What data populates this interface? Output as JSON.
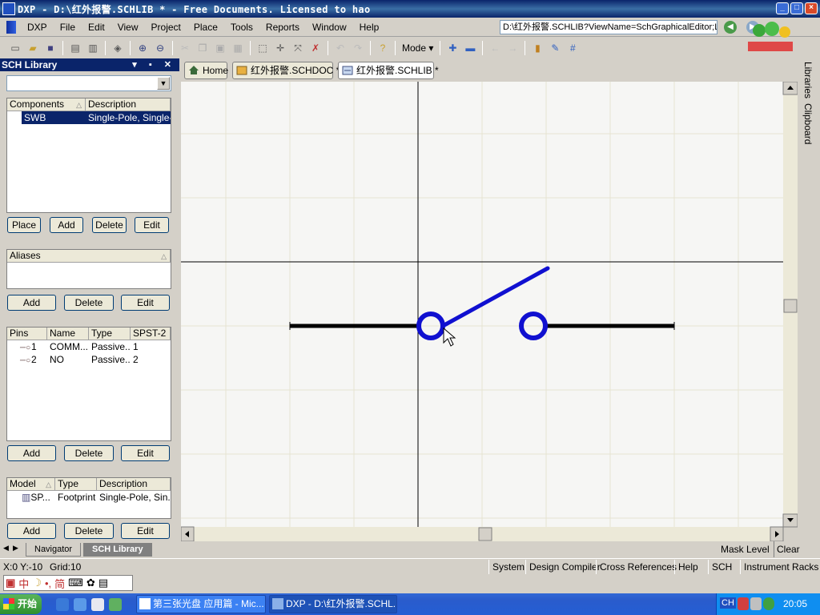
{
  "window": {
    "title": "DXP - D:\\红外报警.SCHLIB * - Free Documents. Licensed to hao",
    "buttons": [
      "minimize",
      "maximize",
      "close"
    ]
  },
  "menu": {
    "logo": "DXP",
    "items": [
      "File",
      "Edit",
      "View",
      "Project",
      "Place",
      "Tools",
      "Reports",
      "Window",
      "Help"
    ],
    "path": "D:\\红外报警.SCHLIB?ViewName=SchGraphicalEditor;L"
  },
  "toolbar": {
    "mode_label": "Mode"
  },
  "panel": {
    "title": "SCH Library",
    "components": {
      "headers": [
        "Components",
        "Description"
      ],
      "rows": [
        {
          "name": "SWB",
          "description": "Single-Pole, Single-..."
        }
      ],
      "buttons": [
        "Place",
        "Add",
        "Delete",
        "Edit"
      ]
    },
    "aliases": {
      "header": "Aliases",
      "buttons": [
        "Add",
        "Delete",
        "Edit"
      ]
    },
    "pins": {
      "headers": [
        "Pins",
        "Name",
        "Type",
        "SPST-2"
      ],
      "rows": [
        {
          "pin": "1",
          "name": "COMM...",
          "type": "Passive...",
          "spst": "1"
        },
        {
          "pin": "2",
          "name": "NO",
          "type": "Passive...",
          "spst": "2"
        }
      ],
      "buttons": [
        "Add",
        "Delete",
        "Edit"
      ]
    },
    "models": {
      "headers": [
        "Model",
        "Type",
        "Description"
      ],
      "rows": [
        {
          "model": "SP...",
          "type": "Footprint",
          "description": "Single-Pole, Sin..."
        }
      ],
      "buttons": [
        "Add",
        "Delete",
        "Edit"
      ]
    },
    "bottom_tabs": [
      "Navigator",
      "SCH Library"
    ]
  },
  "doc_tabs": [
    "Home",
    "红外报警.SCHDOC *",
    "红外报警.SCHLIB *"
  ],
  "right_sidebar": [
    "Libraries",
    "Clipboard"
  ],
  "editor": {
    "status_right": [
      "Mask Level",
      "Clear"
    ]
  },
  "status_bar": {
    "coords": "X:0 Y:-10",
    "grid": "Grid:10",
    "buttons": [
      "System",
      "Design Compiler",
      "Cross References",
      "Help",
      "SCH",
      "Instrument Racks"
    ]
  },
  "ime": {
    "items": [
      "中",
      "简"
    ]
  },
  "taskbar": {
    "start": "开始",
    "tasks": [
      "第三张光盘 应用篇 - Mic...",
      "DXP - D:\\红外报警.SCHL..."
    ],
    "tray_ime": "CH",
    "clock": "20:05"
  },
  "colors": {
    "title_bar": "#0a246a",
    "symbol_blue": "#1010d0",
    "wire_black": "#000000",
    "grid_line": "#e6e4d2",
    "canvas_bg": "#f6f6f4"
  }
}
